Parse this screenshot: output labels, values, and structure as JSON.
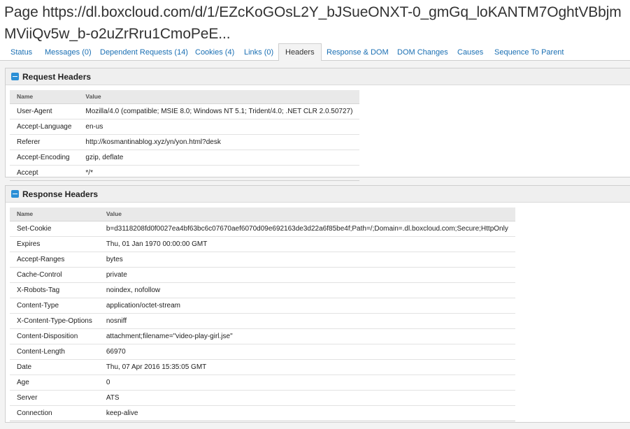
{
  "page": {
    "title": "Page https://dl.boxcloud.com/d/1/EZcKoGOsL2Y_bJSueONXT-0_gmGq_loKANTM7OghtVBbjmMViiQv5w_b-o2uZrRru1CmoPeE..."
  },
  "tabs": [
    {
      "label": "Status"
    },
    {
      "label": "Messages (0)"
    },
    {
      "label": "Dependent Requests (14)"
    },
    {
      "label": "Cookies (4)"
    },
    {
      "label": "Links (0)"
    },
    {
      "label": "Headers"
    },
    {
      "label": "Response & DOM"
    },
    {
      "label": "DOM Changes"
    },
    {
      "label": "Causes"
    },
    {
      "label": "Sequence To Parent"
    }
  ],
  "request_headers": {
    "title": "Request Headers",
    "col_name": "Name",
    "col_value": "Value",
    "rows": [
      {
        "name": "User-Agent",
        "value": "Mozilla/4.0 (compatible; MSIE 8.0; Windows NT 5.1; Trident/4.0; .NET CLR 2.0.50727)"
      },
      {
        "name": "Accept-Language",
        "value": "en-us"
      },
      {
        "name": "Referer",
        "value": "http://kosmantinablog.xyz/yn/yon.html?desk"
      },
      {
        "name": "Accept-Encoding",
        "value": "gzip, deflate"
      },
      {
        "name": "Accept",
        "value": "*/*"
      }
    ]
  },
  "response_headers": {
    "title": "Response Headers",
    "col_name": "Name",
    "col_value": "Value",
    "rows": [
      {
        "name": "Set-Cookie",
        "value": "b=d3118208fd0f0027ea4bf63bc6c07670aef6070d09e692163de3d22a6f85be4f;Path=/;Domain=.dl.boxcloud.com;Secure;HttpOnly"
      },
      {
        "name": "Expires",
        "value": "Thu, 01 Jan 1970 00:00:00 GMT"
      },
      {
        "name": "Accept-Ranges",
        "value": "bytes"
      },
      {
        "name": "Cache-Control",
        "value": "private"
      },
      {
        "name": "X-Robots-Tag",
        "value": "noindex, nofollow"
      },
      {
        "name": "Content-Type",
        "value": "application/octet-stream"
      },
      {
        "name": "X-Content-Type-Options",
        "value": "nosniff"
      },
      {
        "name": "Content-Disposition",
        "value": "attachment;filename=\"video-play-girl.jse\""
      },
      {
        "name": "Content-Length",
        "value": "66970"
      },
      {
        "name": "Date",
        "value": "Thu, 07 Apr 2016 15:35:05 GMT"
      },
      {
        "name": "Age",
        "value": "0"
      },
      {
        "name": "Server",
        "value": "ATS"
      },
      {
        "name": "Connection",
        "value": "keep-alive"
      }
    ]
  }
}
